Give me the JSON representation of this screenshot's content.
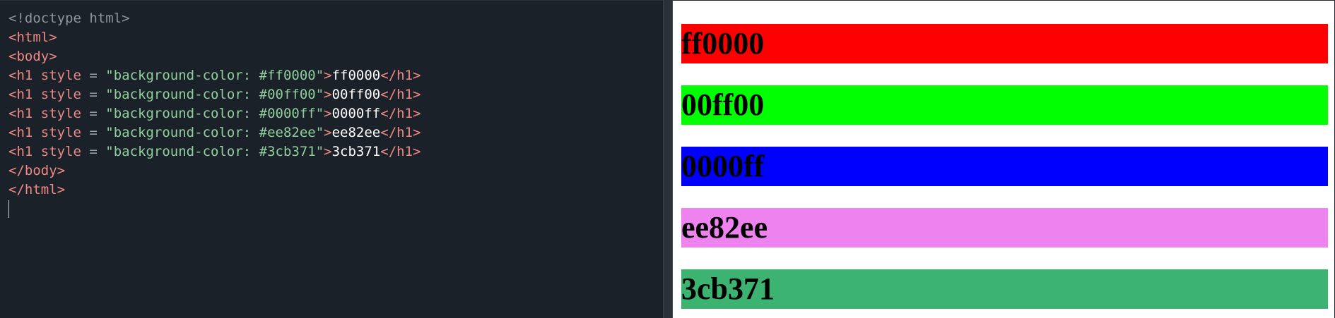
{
  "editor": {
    "lines": [
      {
        "doctype": "<!doctype html>"
      },
      {
        "open": "<html>"
      },
      {
        "open": "<body>"
      },
      {
        "tag_open": "<h1",
        "attr": " style",
        "eq": " = ",
        "value": "\"background-color: #ff0000\"",
        "gt": ">",
        "text": "ff0000",
        "close": "</h1>"
      },
      {
        "tag_open": "<h1",
        "attr": " style",
        "eq": " = ",
        "value": "\"background-color: #00ff00\"",
        "gt": ">",
        "text": "00ff00",
        "close": "</h1>"
      },
      {
        "tag_open": "<h1",
        "attr": " style",
        "eq": " = ",
        "value": "\"background-color: #0000ff\"",
        "gt": ">",
        "text": "0000ff",
        "close": "</h1>"
      },
      {
        "tag_open": "<h1",
        "attr": " style",
        "eq": " = ",
        "value": "\"background-color: #ee82ee\"",
        "gt": ">",
        "text": "ee82ee",
        "close": "</h1>"
      },
      {
        "tag_open": "<h1",
        "attr": " style",
        "eq": " = ",
        "value": "\"background-color: #3cb371\"",
        "gt": ">",
        "text": "3cb371",
        "close": "</h1>"
      },
      {
        "open": "</body>"
      },
      {
        "open": "</html>"
      }
    ]
  },
  "preview": {
    "headings": [
      {
        "text": "ff0000",
        "color": "#ff0000"
      },
      {
        "text": "00ff00",
        "color": "#00ff00"
      },
      {
        "text": "0000ff",
        "color": "#0000ff"
      },
      {
        "text": "ee82ee",
        "color": "#ee82ee"
      },
      {
        "text": "3cb371",
        "color": "#3cb371"
      }
    ]
  }
}
